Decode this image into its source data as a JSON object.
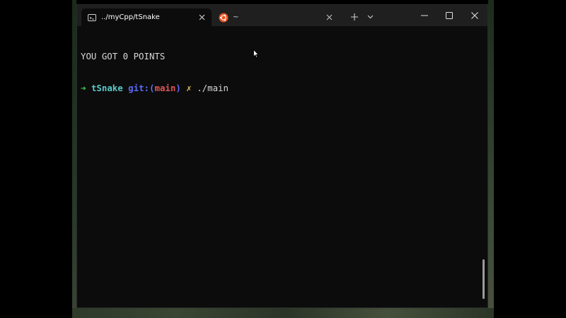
{
  "tabs": [
    {
      "title": "../myCpp/tSnake",
      "icon": "terminal-icon",
      "active": true
    },
    {
      "title": "~",
      "icon": "ubuntu-icon",
      "active": false
    }
  ],
  "toolbar": {
    "new_tab": "+",
    "dropdown": "⌄"
  },
  "terminal": {
    "output_line": "YOU GOT 0 POINTS",
    "prompt": {
      "arrow": "➜",
      "directory": "tSnake",
      "git_prefix": "git:(",
      "branch": "main",
      "git_suffix": ")",
      "dirty_mark": "✗",
      "command": "./main"
    }
  },
  "colors": {
    "background": "#0c0c0c",
    "titlebar": "#1f1f1f",
    "prompt_arrow": "#3fd24c",
    "directory": "#5cc8c8",
    "git": "#5b6cf5",
    "branch": "#e05555",
    "ubuntu": "#e95420"
  }
}
